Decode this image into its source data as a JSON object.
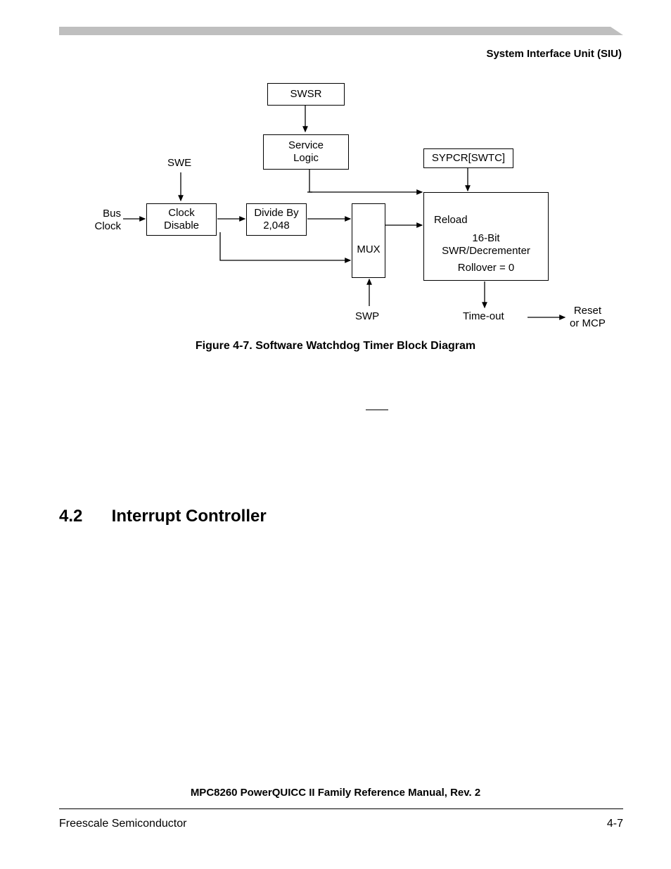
{
  "header": {
    "right": "System Interface Unit (SIU)"
  },
  "diagram": {
    "swsr": "SWSR",
    "service_logic": "Service\nLogic",
    "swe": "SWE",
    "bus_clock": "Bus\nClock",
    "clock_disable": "Clock\nDisable",
    "divide": "Divide By\n2,048",
    "mux": "MUX",
    "sypcr": "SYPCR[SWTC]",
    "reload": "Reload",
    "bit16": "16-Bit\nSWR/Decrementer",
    "rollover": "Rollover = 0",
    "swp": "SWP",
    "timeout": "Time-out",
    "reset": "Reset\nor MCP"
  },
  "figure_caption": "Figure 4-7. Software Watchdog Timer Block Diagram",
  "section": {
    "num": "4.2",
    "title": "Interrupt Controller"
  },
  "footer": {
    "title": "MPC8260 PowerQUICC II Family Reference Manual, Rev. 2",
    "left": "Freescale Semiconductor",
    "right": "4-7"
  }
}
